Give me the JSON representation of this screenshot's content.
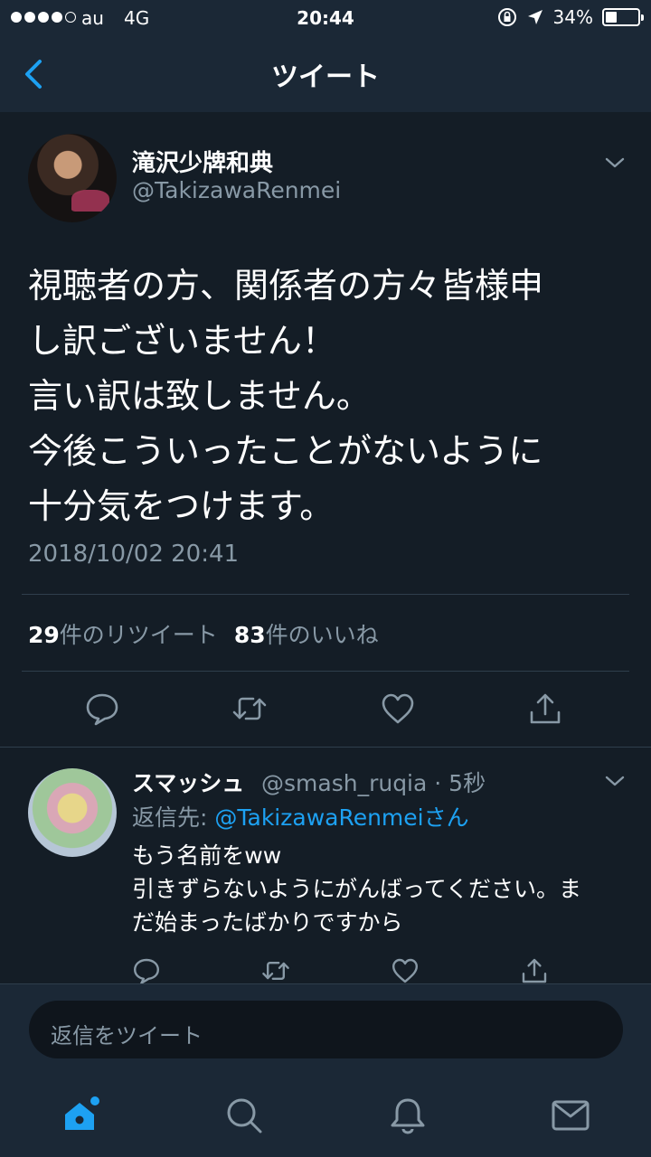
{
  "status_bar": {
    "carrier": "au",
    "network": "4G",
    "time": "20:44",
    "battery_text": "34%",
    "battery_level": 0.34
  },
  "nav": {
    "title": "ツイート"
  },
  "tweet": {
    "author_name": "滝沢少牌和典",
    "author_handle": "@TakizawaRenmei",
    "text": "視聴者の方、関係者の方々皆様申\nし訳ございません！\n言い訳は致しません。\n今後こういったことがないように\n十分気をつけます。",
    "timestamp": "2018/10/02 20:41",
    "retweet_count": "29",
    "retweet_label": "件のリツイート",
    "like_count": "83",
    "like_label": "件のいいね"
  },
  "reply": {
    "name": "スマッシュ",
    "handle_time": "@smash_ruqia · 5秒",
    "reply_to_prefix": "返信先: ",
    "reply_to_mention": "@TakizawaRenmei",
    "reply_to_suffix": "さん",
    "text": "もう名前をww\n引きずらないようにがんばってください。ま\nだ始まったばかりですから"
  },
  "composer": {
    "placeholder": "返信をツイート"
  },
  "colors": {
    "background": "#141d26",
    "bar": "#1b2836",
    "accent": "#1da1f2",
    "secondary": "#8899a6"
  },
  "icons": [
    "back-chevron-icon",
    "reply-icon",
    "retweet-icon",
    "like-icon",
    "share-icon",
    "home-icon",
    "search-icon",
    "notifications-icon",
    "messages-icon"
  ]
}
